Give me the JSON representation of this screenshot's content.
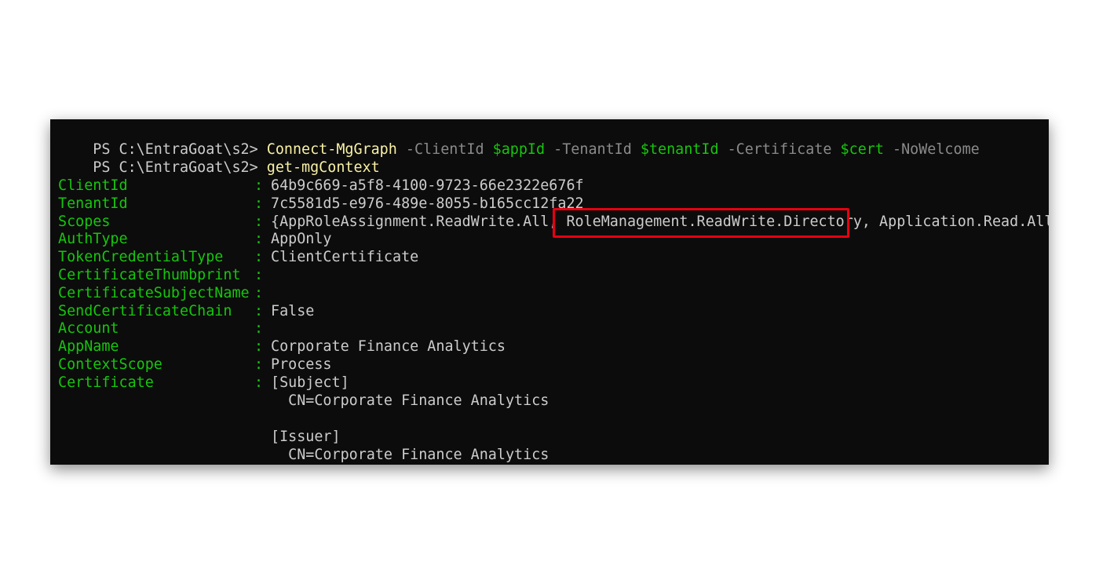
{
  "prompt": "PS C:\\EntraGoat\\s2> ",
  "commands": [
    {
      "cmd": "Connect-MgGraph",
      "args": [
        {
          "type": "param",
          "text": " -ClientId "
        },
        {
          "type": "var",
          "text": "$appId"
        },
        {
          "type": "param",
          "text": " -TenantId "
        },
        {
          "type": "var",
          "text": "$tenantId"
        },
        {
          "type": "param",
          "text": " -Certificate "
        },
        {
          "type": "var",
          "text": "$cert"
        },
        {
          "type": "param",
          "text": " -NoWelcome"
        }
      ]
    },
    {
      "cmd": "get-mgContext",
      "args": []
    }
  ],
  "properties": [
    {
      "key": "ClientId",
      "value": "64b9c669-a5f8-4100-9723-66e2322e676f"
    },
    {
      "key": "TenantId",
      "value": "7c5581d5-e976-489e-8055-b165cc12fa22"
    },
    {
      "key": "Scopes",
      "value": "{AppRoleAssignment.ReadWrite.All, RoleManagement.ReadWrite.Directory, Application.Read.All}"
    },
    {
      "key": "AuthType",
      "value": "AppOnly"
    },
    {
      "key": "TokenCredentialType",
      "value": "ClientCertificate"
    },
    {
      "key": "CertificateThumbprint",
      "value": ""
    },
    {
      "key": "CertificateSubjectName",
      "value": ""
    },
    {
      "key": "SendCertificateChain",
      "value": "False"
    },
    {
      "key": "Account",
      "value": ""
    },
    {
      "key": "AppName",
      "value": "Corporate Finance Analytics"
    },
    {
      "key": "ContextScope",
      "value": "Process"
    },
    {
      "key": "Certificate",
      "value": "[Subject]"
    }
  ],
  "certificate_extra": [
    "  CN=Corporate Finance Analytics",
    "",
    "[Issuer]",
    "  CN=Corporate Finance Analytics"
  ],
  "colors": {
    "background": "#0c0c0c",
    "command": "#f9f1a5",
    "parameter": "#8a8a8a",
    "variable": "#16c60c",
    "property_key": "#16c60c",
    "value": "#cccccc",
    "highlight_border": "#e60012"
  }
}
